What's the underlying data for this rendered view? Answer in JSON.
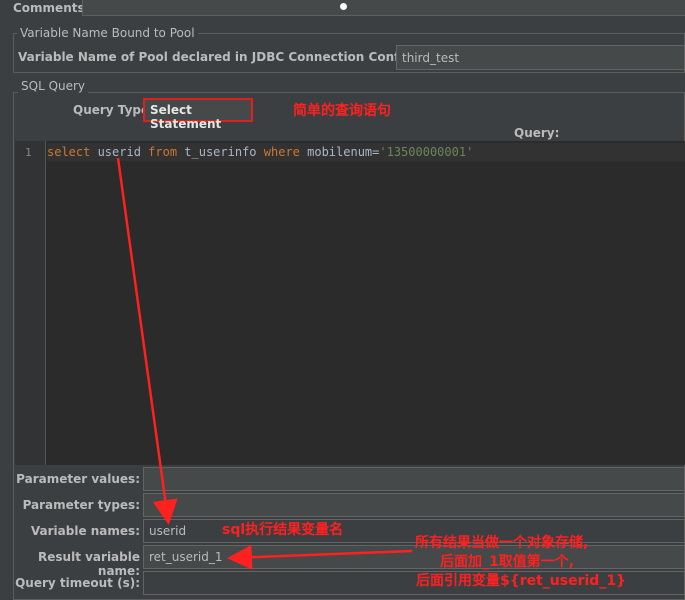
{
  "comments": {
    "label": "Comments:"
  },
  "pool_section": {
    "title": "Variable Name Bound to Pool",
    "label": "Variable Name of Pool declared in JDBC Connection Configuration:",
    "value": "third_test"
  },
  "sql_section": {
    "title": "SQL Query",
    "query_type_label": "Query Type:",
    "query_type_value": "Select Statement",
    "query_label": "Query:"
  },
  "editor": {
    "line_number": "1",
    "tokens": {
      "kw_select": "select",
      "col": " userid ",
      "kw_from": "from",
      "table": " t_userinfo ",
      "kw_where": "where",
      "cond": " mobilenum=",
      "str": "'13500000001'"
    }
  },
  "params": {
    "parameter_values_label": "Parameter values:",
    "parameter_types_label": "Parameter types:",
    "variable_names_label": "Variable names:",
    "variable_names_value": "userid",
    "result_variable_label": "Result variable name:",
    "result_variable_value": "ret_userid_1",
    "query_timeout_label": "Query timeout (s):"
  },
  "annotations": {
    "simple_query": "简单的查询语句",
    "sql_result_var": "sql执行结果变量名",
    "object_line1": "所有结果当做一个对象存储,",
    "object_line2": "后面加_1取值第一个,",
    "object_line3": "后面引用变量${ret_userid_1}"
  },
  "colors": {
    "annotation_red": "#ff2020",
    "keyword_orange": "#cc7832",
    "string_green": "#6a8759"
  }
}
